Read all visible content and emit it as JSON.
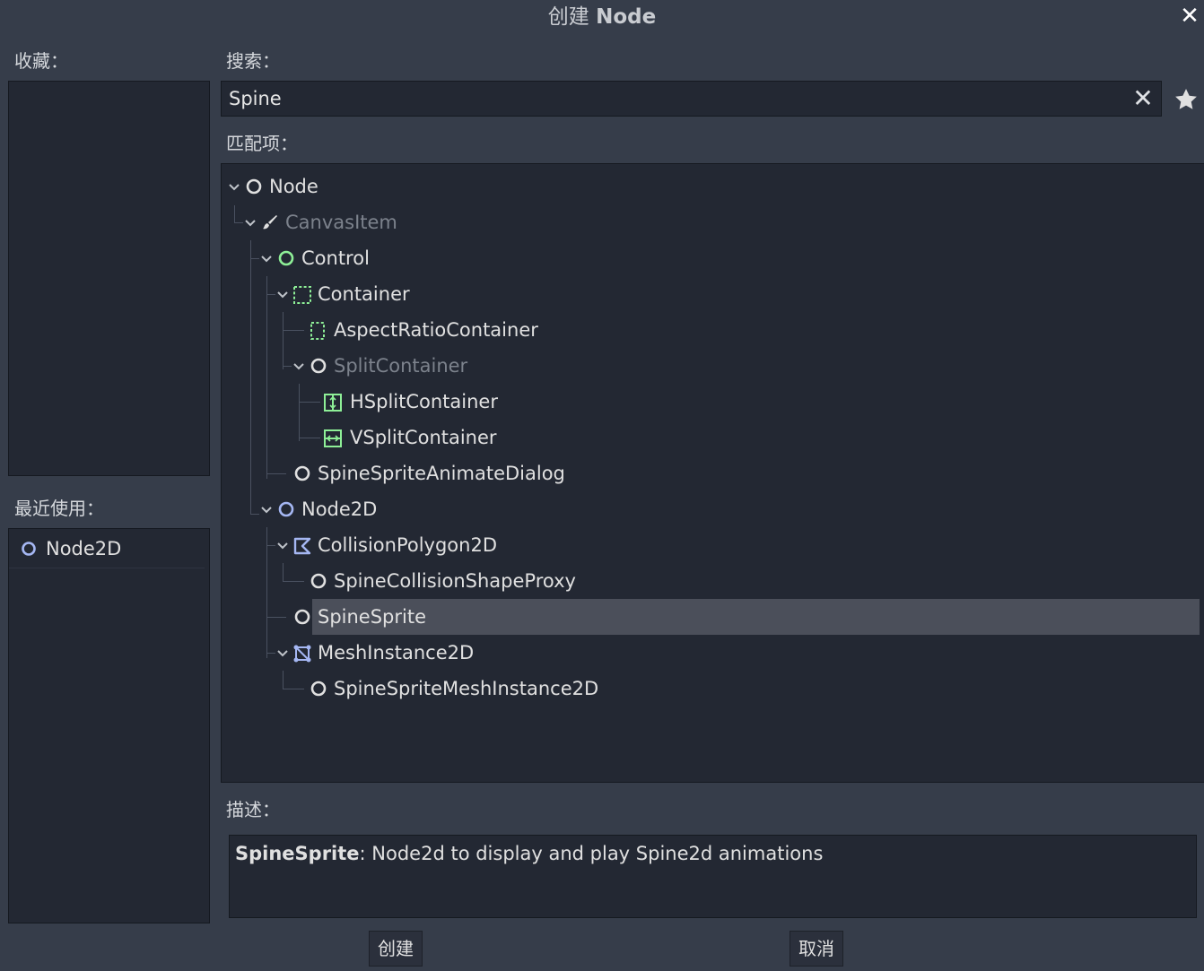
{
  "dialog": {
    "title_prefix": "创建",
    "title_node": "Node",
    "favorites_label": "收藏：",
    "recent_label": "最近使用：",
    "search_label": "搜索：",
    "matches_label": "匹配项：",
    "description_label": "描述："
  },
  "search": {
    "value": "Spine"
  },
  "recent": [
    {
      "label": "Node2D",
      "icon": "node2d-circle-icon"
    }
  ],
  "tree": [
    {
      "label": "Node",
      "icon": "node-circle-icon",
      "dim": false
    },
    {
      "label": "CanvasItem",
      "icon": "brush-icon",
      "dim": true
    },
    {
      "label": "Control",
      "icon": "control-circle-icon",
      "dim": false
    },
    {
      "label": "Container",
      "icon": "container-icon",
      "dim": false
    },
    {
      "label": "AspectRatioContainer",
      "icon": "aspect-ratio-container-icon",
      "dim": false
    },
    {
      "label": "SplitContainer",
      "icon": "node-circle-icon",
      "dim": true
    },
    {
      "label": "HSplitContainer",
      "icon": "hsplit-container-icon",
      "dim": false
    },
    {
      "label": "VSplitContainer",
      "icon": "vsplit-container-icon",
      "dim": false
    },
    {
      "label": "SpineSpriteAnimateDialog",
      "icon": "node-circle-icon",
      "dim": false
    },
    {
      "label": "Node2D",
      "icon": "node2d-circle-icon",
      "dim": false
    },
    {
      "label": "CollisionPolygon2D",
      "icon": "collision-polygon-icon",
      "dim": false
    },
    {
      "label": "SpineCollisionShapeProxy",
      "icon": "node-circle-icon",
      "dim": false
    },
    {
      "label": "SpineSprite",
      "icon": "node-circle-icon",
      "dim": false,
      "selected": true
    },
    {
      "label": "MeshInstance2D",
      "icon": "mesh-instance-icon",
      "dim": false
    },
    {
      "label": "SpineSpriteMeshInstance2D",
      "icon": "node-circle-icon",
      "dim": false
    }
  ],
  "description": {
    "name": "SpineSprite",
    "text": ": Node2d to display and play Spine2d animations"
  },
  "buttons": {
    "create": "创建",
    "cancel": "取消"
  },
  "colors": {
    "background": "#363d4a",
    "panel": "#232833",
    "selection": "#4b4f5a",
    "control_green": "#8eef97",
    "node2d_blue": "#a5b7f3"
  }
}
